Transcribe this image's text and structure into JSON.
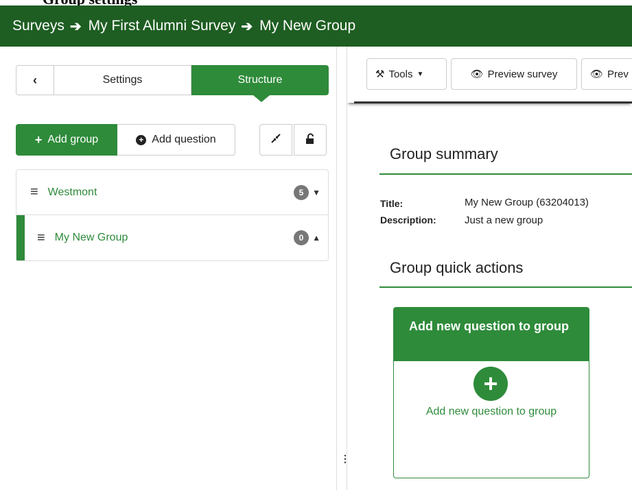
{
  "page_header": {
    "cropped_text": "Group settings"
  },
  "breadcrumb": {
    "items": [
      "Surveys",
      "My First Alumni Survey",
      "My New Group"
    ],
    "separator_icon": "arrow-right-icon"
  },
  "sidebar": {
    "tabs": {
      "back_icon": "chevron-left-icon",
      "settings": "Settings",
      "structure": "Structure"
    },
    "buttons": {
      "add_group": "Add group",
      "add_question": "Add question"
    },
    "groups": [
      {
        "label": "Westmont",
        "count": "5",
        "expanded": false
      },
      {
        "label": "My New Group",
        "count": "0",
        "expanded": true
      }
    ]
  },
  "toolbar": {
    "tools": "Tools",
    "preview_survey": "Preview survey",
    "preview_partial": "Prev"
  },
  "main": {
    "summary_title": "Group summary",
    "title_label": "Title:",
    "title_value": "My New Group (63204013)",
    "description_label": "Description:",
    "description_value": "Just a new group",
    "quick_actions_title": "Group quick actions",
    "card": {
      "header": "Add new question to group",
      "link": "Add new question to group"
    }
  },
  "colors": {
    "brand_dark": "#1e5e22",
    "accent": "#2e8b3a",
    "badge": "#777777"
  }
}
